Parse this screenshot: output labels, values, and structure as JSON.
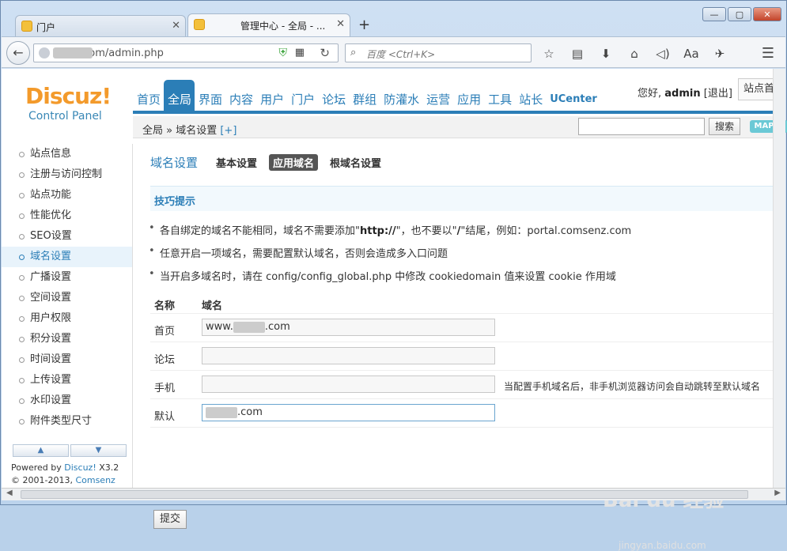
{
  "browser": {
    "tabs": [
      {
        "title": "门户",
        "active": false
      },
      {
        "title": "管理中心 - 全局 - ...",
        "active": true
      }
    ],
    "newtab": "+",
    "window_controls": {
      "minimize": "—",
      "maximize": "▢",
      "close": "✕"
    },
    "url": ".com/admin.php",
    "search_placeholder": "百度 <Ctrl+K>"
  },
  "header": {
    "logo": "Discuz!",
    "logo_sub": "Control Panel",
    "nav": [
      "首页",
      "全局",
      "界面",
      "内容",
      "用户",
      "门户",
      "论坛",
      "群组",
      "防灌水",
      "运营",
      "应用",
      "工具",
      "站长",
      "UCenter"
    ],
    "active_nav": "全局",
    "greeting": "您好,",
    "username": "admin",
    "logout": "[退出]",
    "site_home": "站点首页"
  },
  "subbar": {
    "breadcrumb": "全局 » 域名设置",
    "plus": "[+]",
    "search_button": "搜索",
    "map_button": "MAP ↓"
  },
  "sidebar": {
    "items": [
      "站点信息",
      "注册与访问控制",
      "站点功能",
      "性能优化",
      "SEO设置",
      "域名设置",
      "广播设置",
      "空间设置",
      "用户权限",
      "积分设置",
      "时间设置",
      "上传设置",
      "水印设置",
      "附件类型尺寸"
    ],
    "active": "域名设置",
    "up_arrow": "▲",
    "down_arrow": "▼",
    "powered_label": "Powered by",
    "powered_brand": "Discuz!",
    "powered_version": "X3.2",
    "copyright_prefix": "© 2001-2013,",
    "copyright_company": "Comsenz Inc."
  },
  "content": {
    "title": "域名设置",
    "subtabs": [
      "基本设置",
      "应用域名",
      "根域名设置"
    ],
    "active_subtab": "应用域名",
    "tips_title": "技巧提示",
    "tips": {
      "t1_a": "各自绑定的域名不能相同，域名不需要添加\"",
      "t1_b": "http://",
      "t1_c": "\"，也不要以\"",
      "t1_d": "/",
      "t1_e": "\"结尾，例如：portal.comsenz.com",
      "t2": "任意开启一项域名，需要配置默认域名，否则会造成多入口问题",
      "t3": "当开启多域名时，请在 config/config_global.php 中修改 cookiedomain 值来设置 cookie 作用域"
    },
    "table_headers": {
      "name": "名称",
      "domain": "域名"
    },
    "rows": [
      {
        "label": "首页",
        "prefix": "www.",
        "suffix": ".com",
        "note": ""
      },
      {
        "label": "论坛",
        "prefix": "",
        "suffix": "",
        "note": ""
      },
      {
        "label": "手机",
        "prefix": "",
        "suffix": "",
        "note": "当配置手机域名后，非手机浏览器访问会自动跳转至默认域名"
      },
      {
        "label": "默认",
        "prefix": "",
        "suffix": ".com",
        "note": ""
      }
    ],
    "submit": "提交"
  },
  "watermark": {
    "main": "Bai du 经验",
    "sub": "jingyan.baidu.com"
  }
}
